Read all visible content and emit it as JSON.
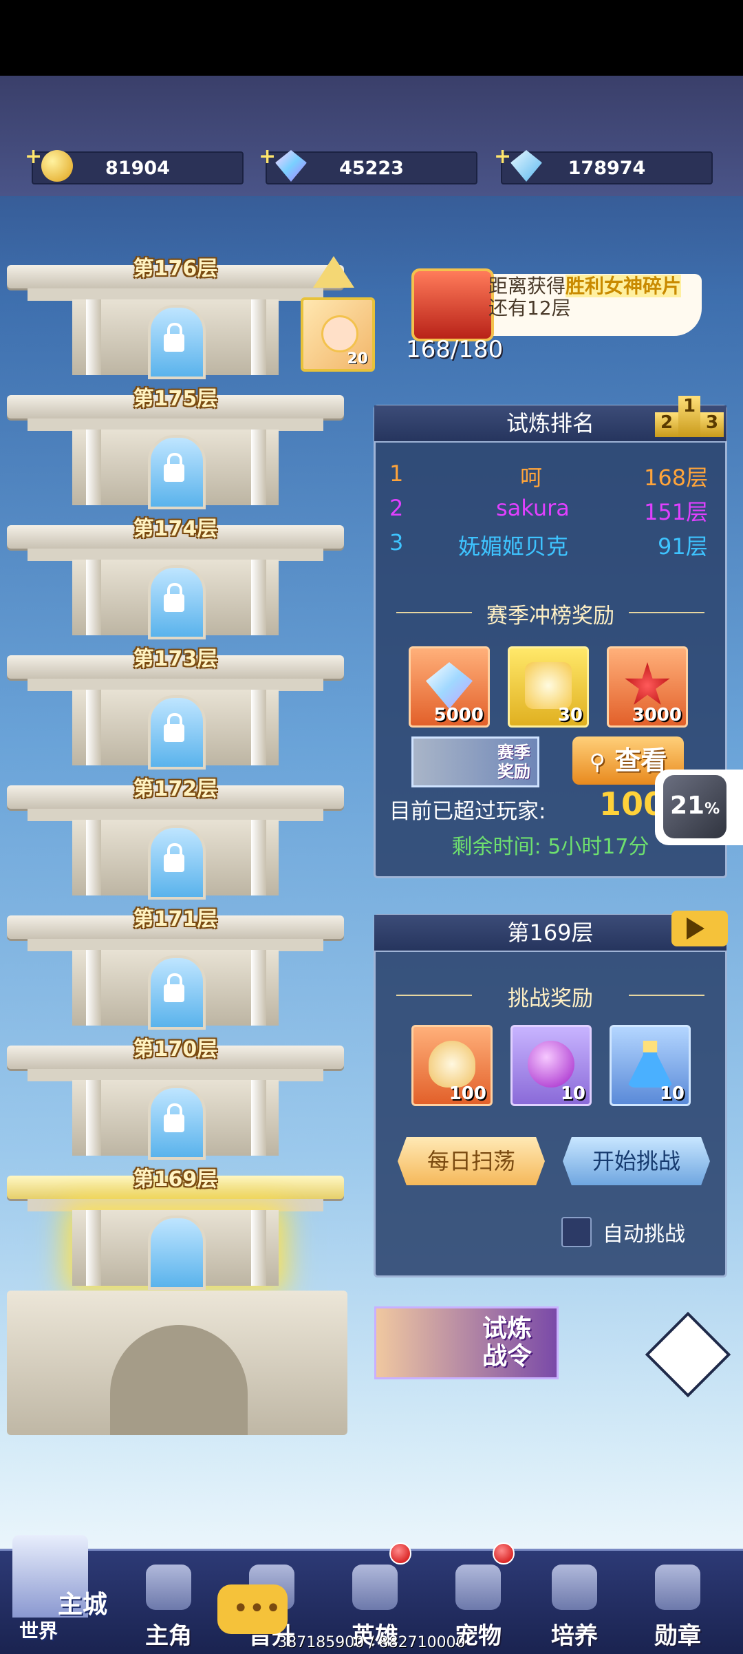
{
  "resources": [
    {
      "icon": "gold-coin-icon",
      "value": "81904",
      "color": "#f5c23a"
    },
    {
      "icon": "rainbow-crystal-icon",
      "value": "45223",
      "color": "#d29cff"
    },
    {
      "icon": "diamond-icon",
      "value": "178974",
      "color": "#8fd4ff"
    }
  ],
  "tower": {
    "floors": [
      {
        "label": "第176层"
      },
      {
        "label": "第175层"
      },
      {
        "label": "第174层"
      },
      {
        "label": "第173层"
      },
      {
        "label": "第172层"
      },
      {
        "label": "第171层"
      },
      {
        "label": "第170层"
      },
      {
        "label": "第169层",
        "active": true
      }
    ],
    "avatar_level": "20"
  },
  "chest": {
    "prefix": "距离获得",
    "highlight": "胜利女神碎片",
    "suffix": "还有12层",
    "progress": "168/180"
  },
  "ranking": {
    "title": "试炼排名",
    "podium": [
      "2",
      "1",
      "3"
    ],
    "rows": [
      {
        "rank": "1",
        "name": "呵",
        "floor": "168层",
        "color": "#ffa43a"
      },
      {
        "rank": "2",
        "name": "sakura",
        "floor": "151层",
        "color": "#e040ff"
      },
      {
        "rank": "3",
        "name": "妩媚姬贝克",
        "floor": "91层",
        "color": "#3ec4ff"
      }
    ],
    "season_title": "赛季冲榜奖励",
    "rewards": [
      {
        "icon": "crystal-icon",
        "qty": "5000"
      },
      {
        "icon": "golden-flame-icon",
        "qty": "30"
      },
      {
        "icon": "ruby-star-icon",
        "qty": "3000"
      }
    ],
    "season_thumb": "赛季\n奖励",
    "view_button": "查看",
    "exceed_label": "目前已超过玩家:",
    "exceed_value": "100",
    "time_left": "剩余时间: 5小时17分"
  },
  "float_badge": {
    "percent": "21",
    "unit": "%"
  },
  "challenge": {
    "title": "第169层",
    "reward_title": "挑战奖励",
    "rewards": [
      {
        "icon": "skull-flame-icon",
        "qty": "100"
      },
      {
        "icon": "purple-orb-icon",
        "qty": "10"
      },
      {
        "icon": "potion-icon",
        "qty": "10"
      }
    ],
    "sweep_button": "每日扫荡",
    "start_button": "开始挑战",
    "auto_label": "自动挑战"
  },
  "trial_banner": "试炼\n战令",
  "nav": {
    "castle_main": "主城",
    "castle_world": "世界",
    "items": [
      {
        "label": "主角",
        "icon": "hero-helmet-icon"
      },
      {
        "label": "晋升",
        "icon": "promotion-icon"
      },
      {
        "label": "英雄",
        "icon": "knight-helmet-icon",
        "dot": true
      },
      {
        "label": "宠物",
        "icon": "pet-icon",
        "dot": true
      },
      {
        "label": "培养",
        "icon": "training-icon"
      },
      {
        "label": "勋章",
        "icon": "medal-icon"
      }
    ]
  },
  "footer": "387185900 / 882710000"
}
